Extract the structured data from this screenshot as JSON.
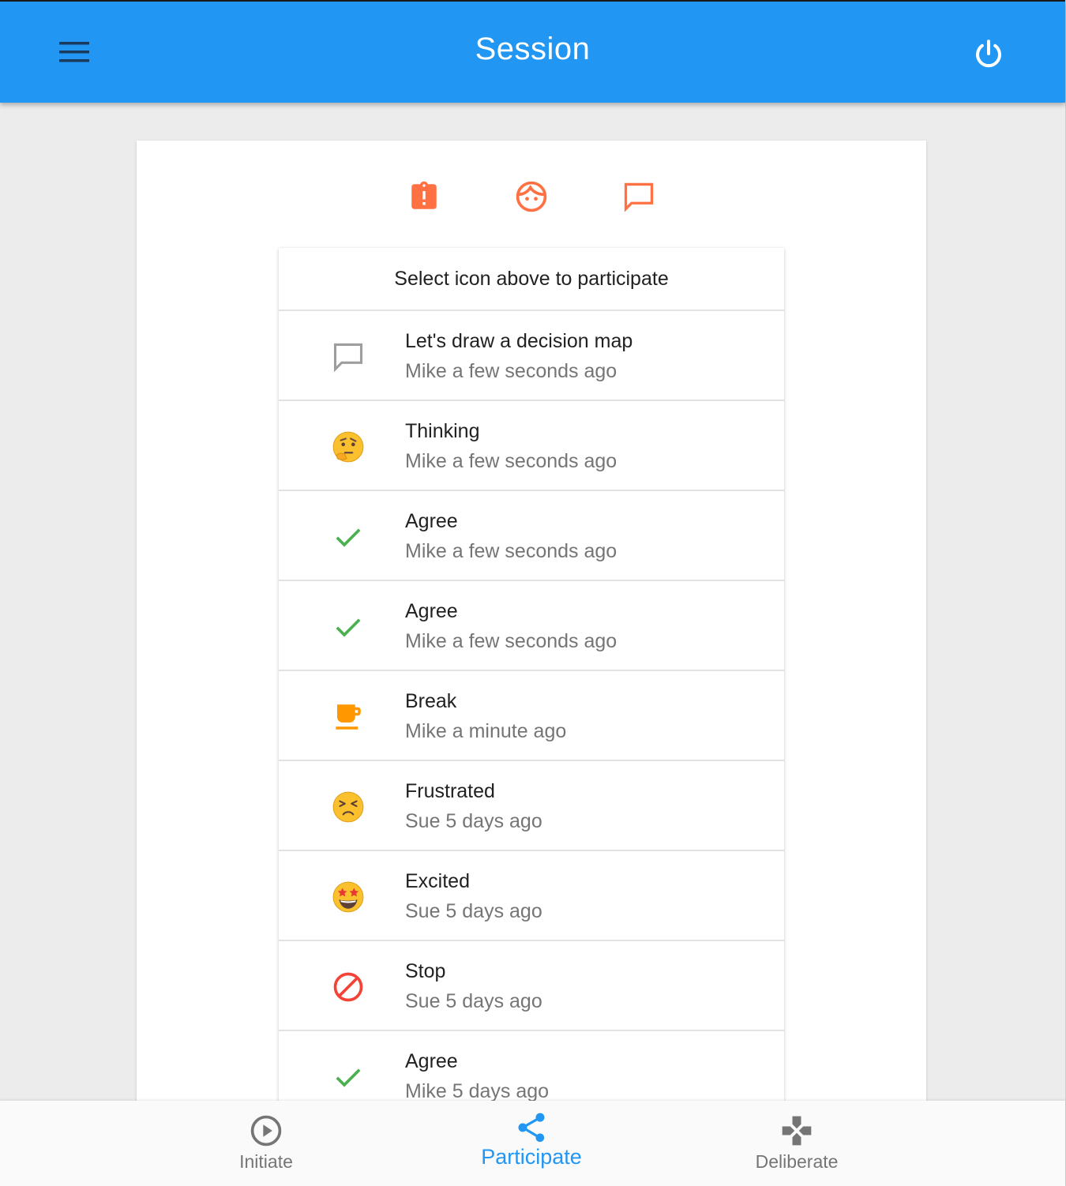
{
  "app_bar": {
    "title": "Session",
    "menu_icon": "menu-icon",
    "power_icon": "power-icon",
    "background_color": "#2196f3"
  },
  "actions": [
    {
      "icon": "assignment-alert-icon",
      "color": "#ff7043"
    },
    {
      "icon": "face-icon",
      "color": "#ff7043"
    },
    {
      "icon": "comment-icon",
      "color": "#ff7043"
    }
  ],
  "feed": {
    "header": "Select icon above to participate",
    "items": [
      {
        "title": "Let's draw a decision map",
        "subtitle": "Mike a few seconds ago",
        "icon": "comment-outline-icon"
      },
      {
        "title": "Thinking",
        "subtitle": "Mike a few seconds ago",
        "icon": "thinking-face-icon"
      },
      {
        "title": "Agree",
        "subtitle": "Mike a few seconds ago",
        "icon": "check-icon"
      },
      {
        "title": "Agree",
        "subtitle": "Mike a few seconds ago",
        "icon": "check-icon"
      },
      {
        "title": "Break",
        "subtitle": "Mike a minute ago",
        "icon": "coffee-cup-icon"
      },
      {
        "title": "Frustrated",
        "subtitle": "Sue 5 days ago",
        "icon": "frustrated-face-icon"
      },
      {
        "title": "Excited",
        "subtitle": "Sue 5 days ago",
        "icon": "star-struck-face-icon"
      },
      {
        "title": "Stop",
        "subtitle": "Sue 5 days ago",
        "icon": "block-icon"
      },
      {
        "title": "Agree",
        "subtitle": "Mike 5 days ago",
        "icon": "check-icon"
      }
    ]
  },
  "bottom_nav": {
    "items": [
      {
        "label": "Initiate",
        "icon": "play-circle-icon",
        "active": false
      },
      {
        "label": "Participate",
        "icon": "share-icon",
        "active": true
      },
      {
        "label": "Deliberate",
        "icon": "gamepad-icon",
        "active": false
      }
    ],
    "active_color": "#2196f3"
  }
}
